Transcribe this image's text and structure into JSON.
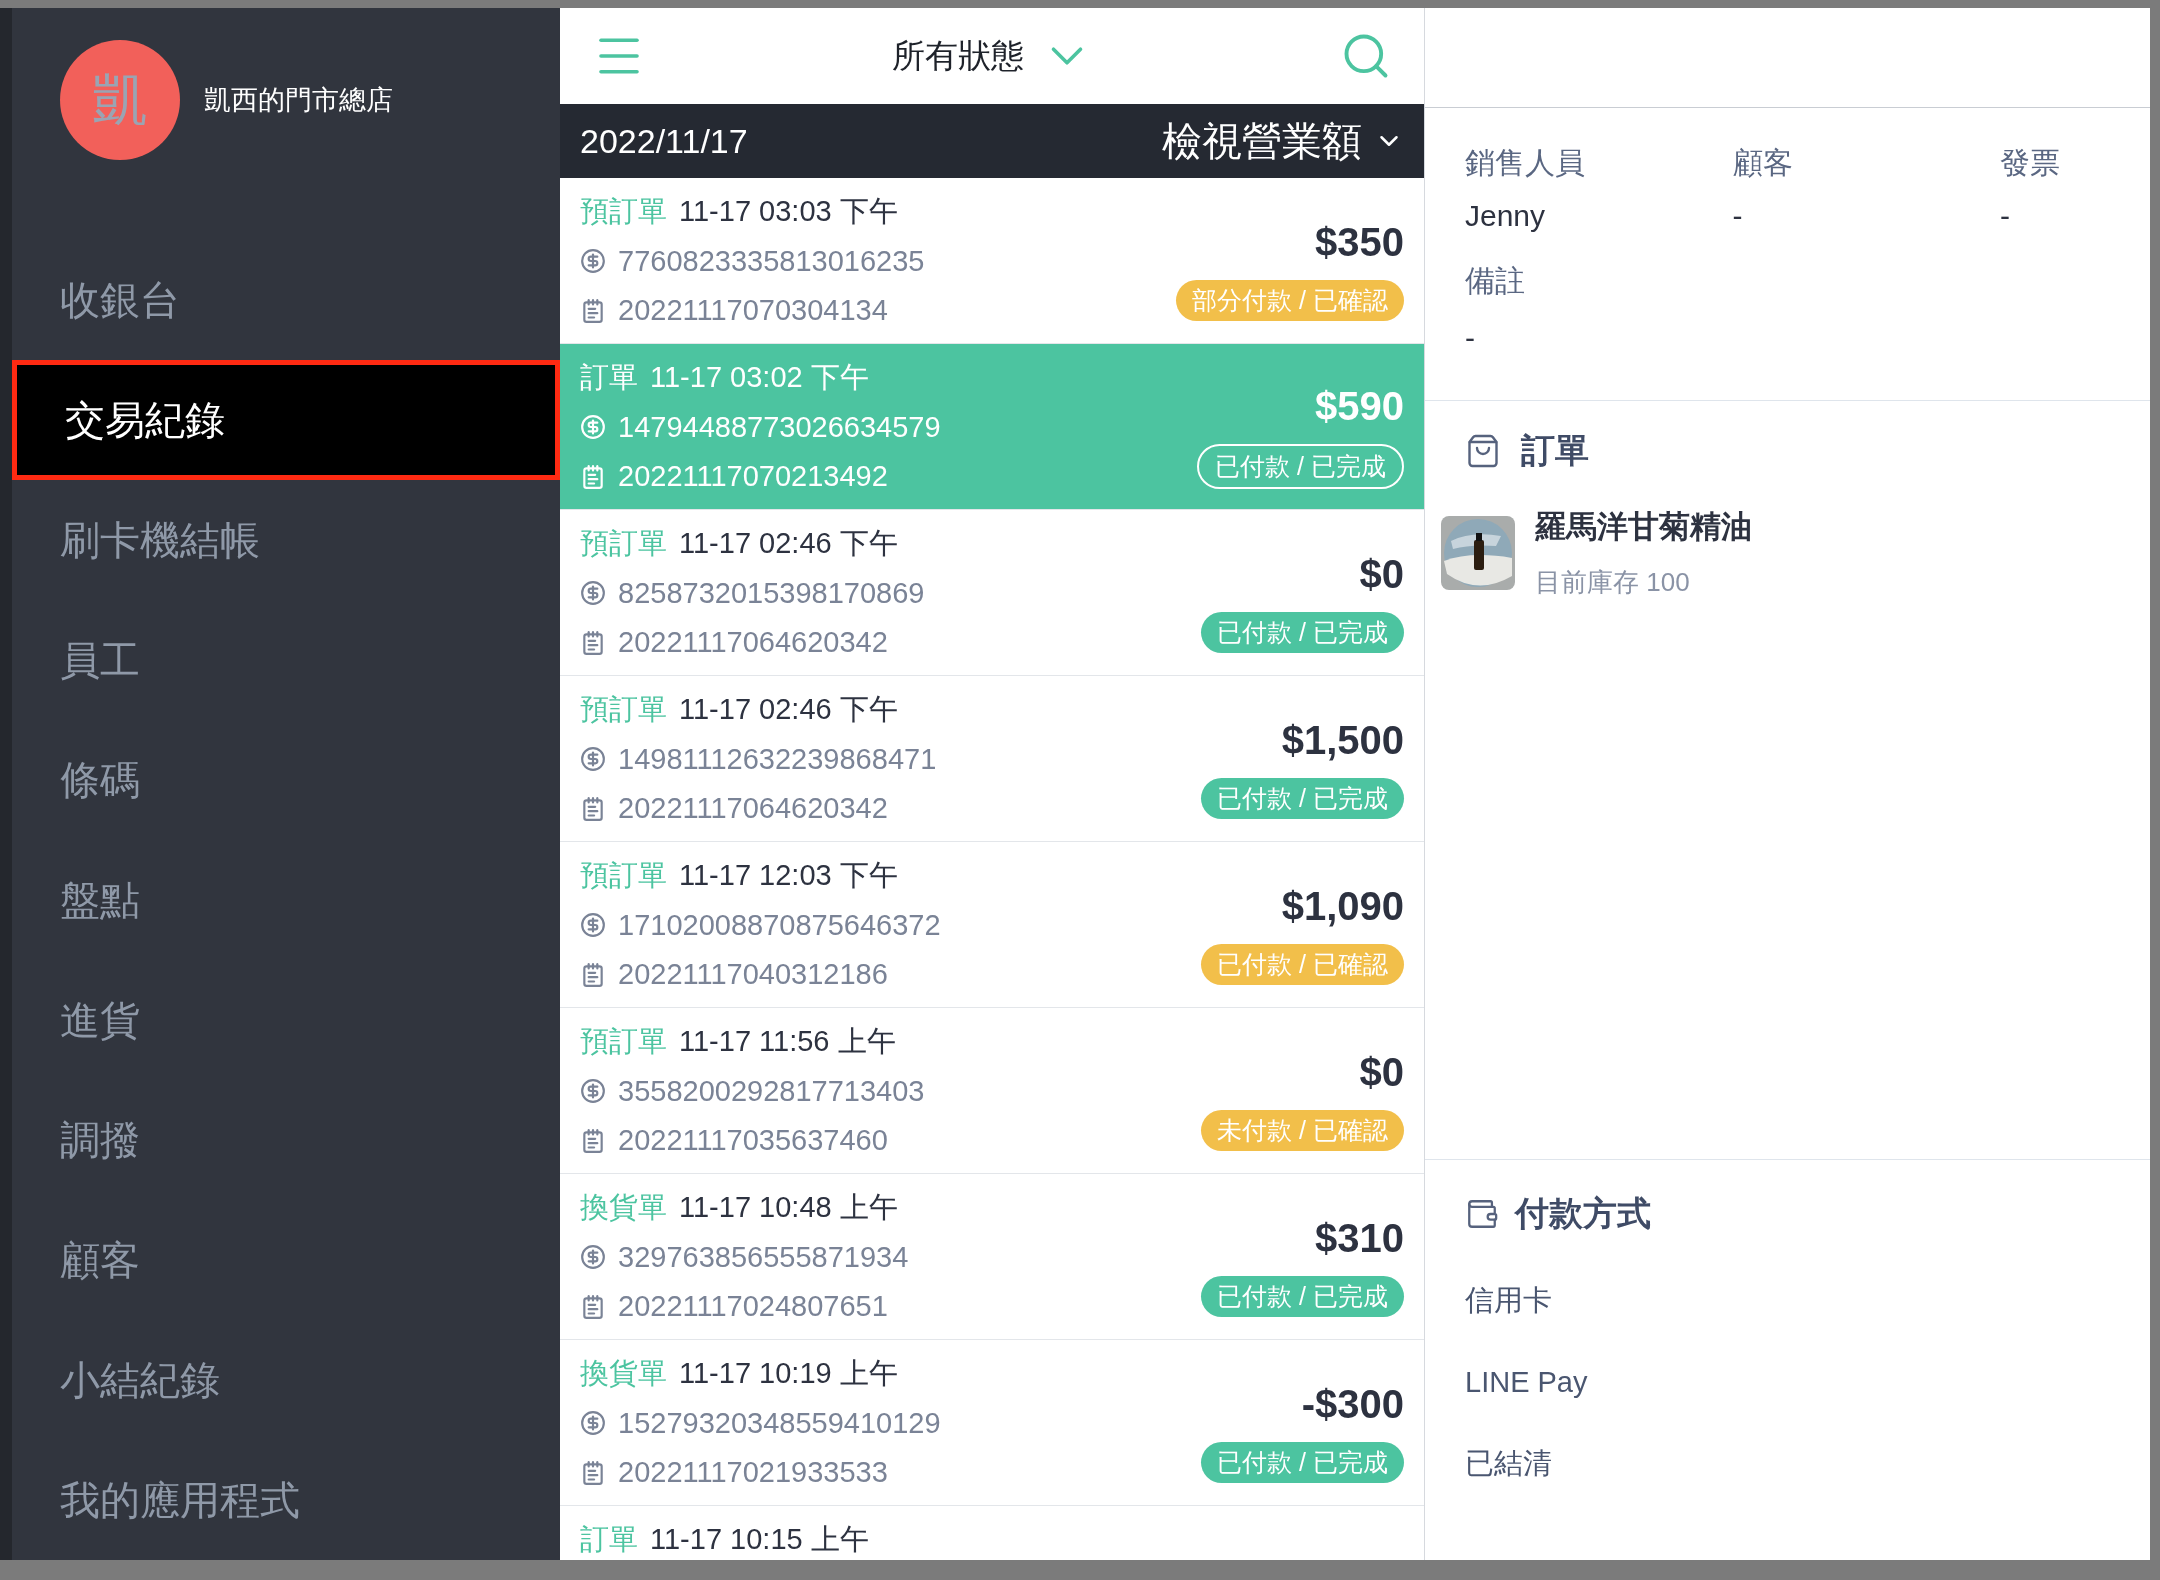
{
  "store": {
    "avatar_text": "凱",
    "name": "凱西的門市總店"
  },
  "nav": [
    {
      "label": "收銀台",
      "selected": false
    },
    {
      "label": "交易紀錄",
      "selected": true
    },
    {
      "label": "刷卡機結帳",
      "selected": false
    },
    {
      "label": "員工",
      "selected": false
    },
    {
      "label": "條碼",
      "selected": false
    },
    {
      "label": "盤點",
      "selected": false
    },
    {
      "label": "進貨",
      "selected": false
    },
    {
      "label": "調撥",
      "selected": false
    },
    {
      "label": "顧客",
      "selected": false
    },
    {
      "label": "小結紀錄",
      "selected": false
    },
    {
      "label": "我的應用程式",
      "selected": false
    }
  ],
  "toolbar": {
    "filter": "所有狀態"
  },
  "date_bar": {
    "date": "2022/11/17",
    "action": "檢視營業額"
  },
  "orders": [
    {
      "type": "預訂單",
      "time": "11-17 03:03 下午",
      "payment_id": "7760823335813016235",
      "order_no": "20221117070304134",
      "amount": "$350",
      "status": "部分付款 / 已確認",
      "color": "#f2bf4a",
      "selected": false
    },
    {
      "type": "訂單",
      "time": "11-17 03:02 下午",
      "payment_id": "14794488773026634579",
      "order_no": "20221117070213492",
      "amount": "$590",
      "status": "已付款 / 已完成",
      "selected": true
    },
    {
      "type": "預訂單",
      "time": "11-17 02:46 下午",
      "payment_id": "8258732015398170869",
      "order_no": "20221117064620342",
      "amount": "$0",
      "status": "已付款 / 已完成",
      "color": "#4cc4a0",
      "selected": false
    },
    {
      "type": "預訂單",
      "time": "11-17 02:46 下午",
      "payment_id": "14981112632239868471",
      "order_no": "20221117064620342",
      "amount": "$1,500",
      "status": "已付款 / 已完成",
      "color": "#4cc4a0",
      "selected": false
    },
    {
      "type": "預訂單",
      "time": "11-17 12:03 下午",
      "payment_id": "17102008870875646372",
      "order_no": "20221117040312186",
      "amount": "$1,090",
      "status": "已付款 / 已確認",
      "color": "#f2bf4a",
      "selected": false
    },
    {
      "type": "預訂單",
      "time": "11-17 11:56 上午",
      "payment_id": "3558200292817713403",
      "order_no": "20221117035637460",
      "amount": "$0",
      "status": "未付款 / 已確認",
      "color": "#f2bf4a",
      "selected": false
    },
    {
      "type": "換貨單",
      "time": "11-17 10:48 上午",
      "payment_id": "329763856555871934",
      "order_no": "20221117024807651",
      "amount": "$310",
      "status": "已付款 / 已完成",
      "color": "#4cc4a0",
      "selected": false
    },
    {
      "type": "換貨單",
      "time": "11-17 10:19 上午",
      "payment_id": "15279320348559410129",
      "order_no": "20221117021933533",
      "amount": "-$300",
      "status": "已付款 / 已完成",
      "color": "#4cc4a0",
      "selected": false
    },
    {
      "type": "訂單",
      "time": "11-17 10:15 上午",
      "selected": false
    }
  ],
  "detail": {
    "fields": [
      {
        "label": "銷售人員",
        "value": "Jenny"
      },
      {
        "label": "顧客",
        "value": "-"
      },
      {
        "label": "發票",
        "value": "-"
      }
    ],
    "note": {
      "label": "備註",
      "value": "-"
    },
    "order_section": {
      "title": "訂單",
      "items": [
        {
          "name": "羅馬洋甘菊精油",
          "stock": "目前庫存 100"
        }
      ]
    },
    "payment_section": {
      "title": "付款方式",
      "lines": [
        "信用卡",
        "LINE Pay",
        "已結清"
      ]
    }
  }
}
